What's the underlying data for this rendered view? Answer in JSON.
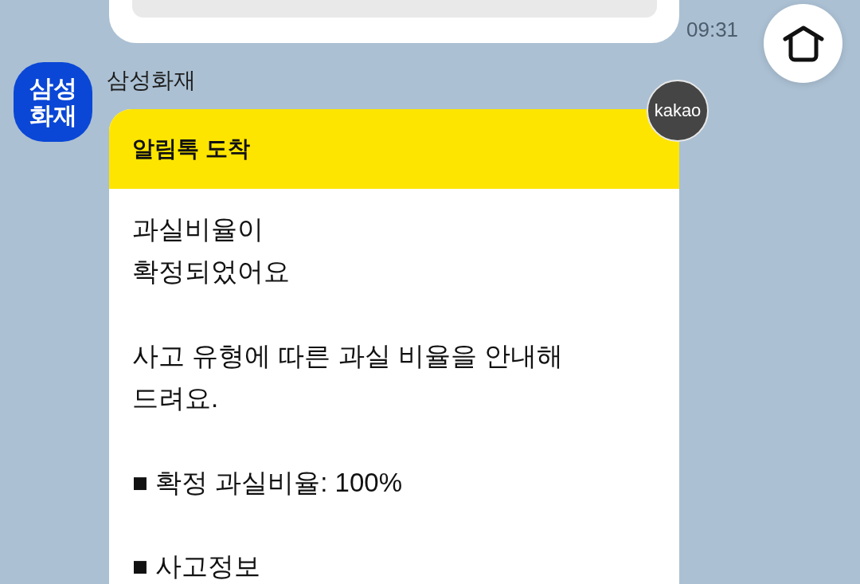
{
  "previous_message": {
    "time": "09:31"
  },
  "message": {
    "avatar_text": "삼성\n화재",
    "sender": "삼성화재",
    "badge": "kakao",
    "header": "알림톡 도착",
    "paragraphs": [
      "과실비율이\n확정되었어요",
      "사고 유형에 따른 과실 비율을 안내해\n드려요.",
      "■ 확정 과실비율: 100%",
      "■ 사고정보"
    ]
  }
}
